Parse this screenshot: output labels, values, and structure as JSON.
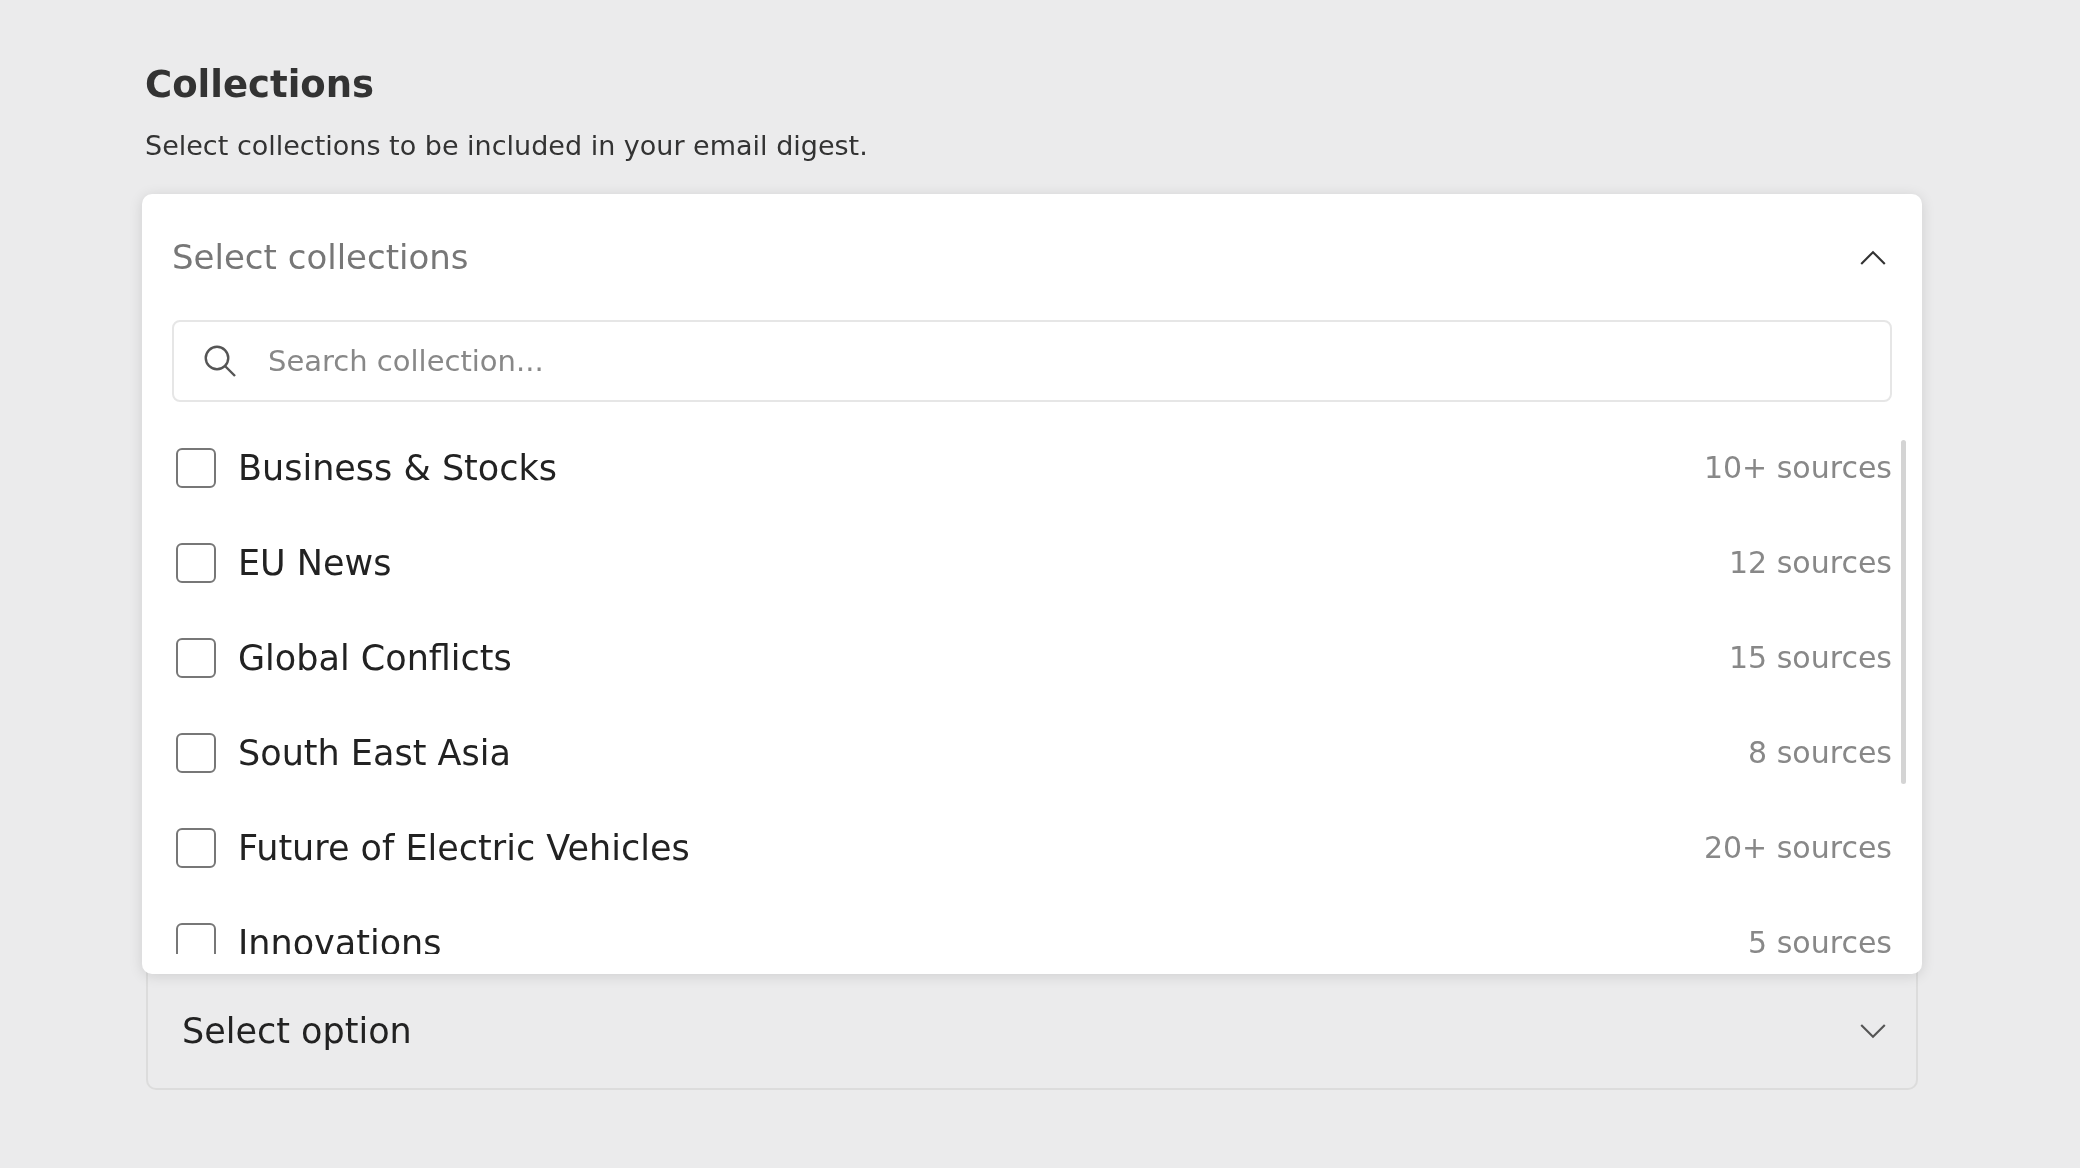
{
  "section": {
    "title": "Collections",
    "description": "Select collections to be included in your email digest."
  },
  "dropdown": {
    "placeholder": "Select collections",
    "expanded": true,
    "search": {
      "placeholder": "Search collection..."
    },
    "items": [
      {
        "label": "Business & Stocks",
        "count": "10+ sources",
        "checked": false
      },
      {
        "label": "EU News",
        "count": "12 sources",
        "checked": false
      },
      {
        "label": "Global Conflicts",
        "count": "15 sources",
        "checked": false
      },
      {
        "label": "South East Asia",
        "count": "8 sources",
        "checked": false
      },
      {
        "label": "Future of Electric Vehicles",
        "count": "20+ sources",
        "checked": false
      },
      {
        "label": "Innovations",
        "count": "5 sources",
        "checked": false
      }
    ]
  },
  "select": {
    "value": "Select option",
    "expanded": false
  }
}
